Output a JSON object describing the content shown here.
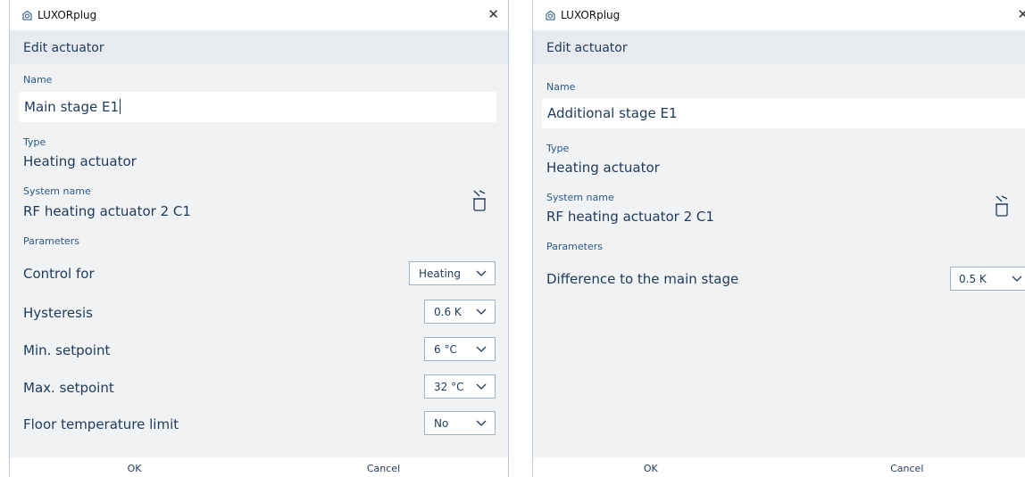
{
  "left": {
    "window_title": "LUXORplug",
    "header": "Edit actuator",
    "name_label": "Name",
    "name_value": "Main stage E1",
    "type_label": "Type",
    "type_value": "Heating actuator",
    "system_label": "System name",
    "system_value": "RF heating actuator 2 C1",
    "params_label": "Parameters",
    "params": [
      {
        "label": "Control for",
        "value": "Heating"
      },
      {
        "label": "Hysteresis",
        "value": "0.6 K"
      },
      {
        "label": "Min. setpoint",
        "value": "6 °C"
      },
      {
        "label": "Max. setpoint",
        "value": "32 °C"
      },
      {
        "label": "Floor temperature limit",
        "value": "No"
      }
    ],
    "ok": "OK",
    "cancel": "Cancel"
  },
  "right": {
    "window_title": "LUXORplug",
    "header": "Edit actuator",
    "name_label": "Name",
    "name_value": "Additional stage E1",
    "type_label": "Type",
    "type_value": "Heating actuator",
    "system_label": "System name",
    "system_value": "RF heating actuator 2 C1",
    "params_label": "Parameters",
    "params": [
      {
        "label": "Difference to the main stage",
        "value": "0.5 K"
      }
    ],
    "ok": "OK",
    "cancel": "Cancel"
  },
  "close_glyph": "✕",
  "icons": [
    "app-icon",
    "close-icon",
    "delete-icon",
    "chevron-down-icon"
  ]
}
